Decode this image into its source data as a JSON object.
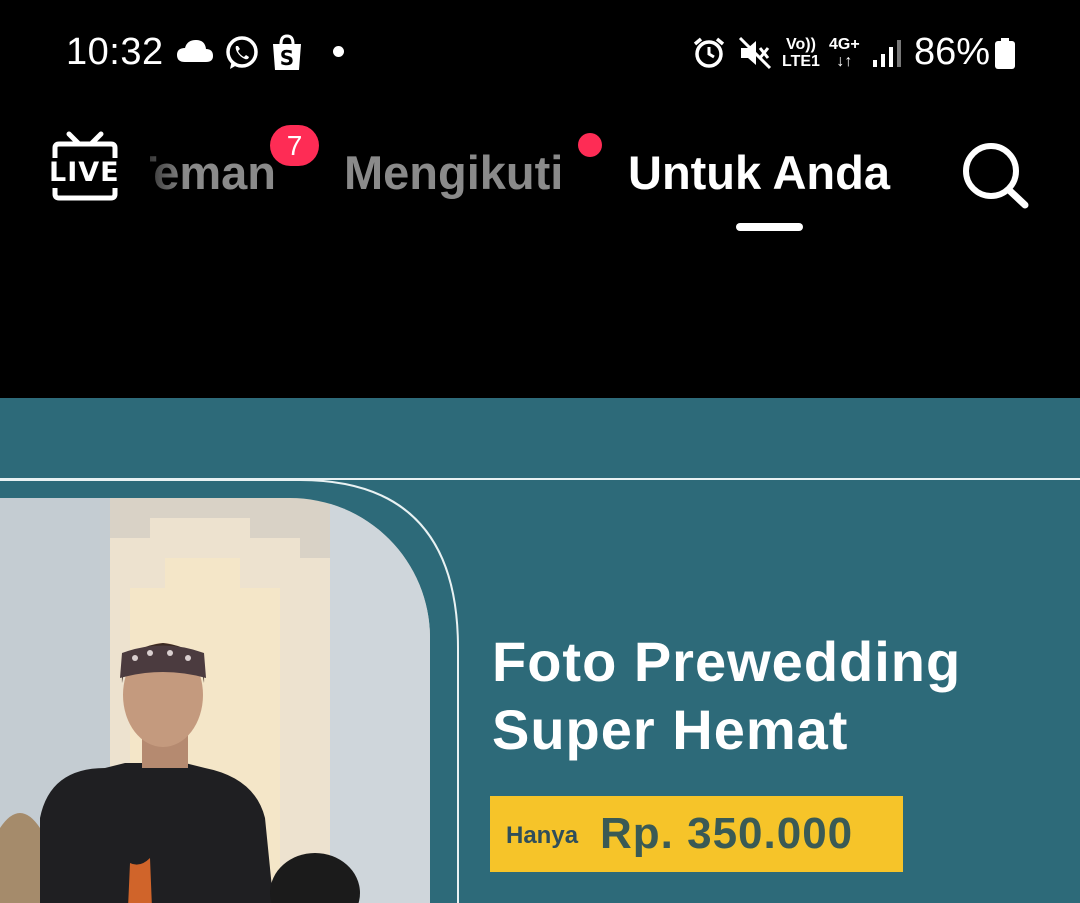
{
  "status_bar": {
    "time": "10:32",
    "icons": [
      "cloud-icon",
      "whatsapp-icon",
      "shopee-icon",
      "dot-icon",
      "alarm-icon",
      "mute-icon",
      "signal-icon",
      "battery-icon"
    ],
    "volte_line1": "Vo))",
    "volte_line2": "LTE1",
    "network_line1": "4G+",
    "network_line2": "↓↑",
    "battery": "86%"
  },
  "nav": {
    "live_label": "LIVE",
    "tab_friends": "Teman",
    "friends_badge": "7",
    "tab_following": "Mengikuti",
    "tab_for_you": "Untuk Anda",
    "active_tab": "Untuk Anda"
  },
  "ad": {
    "title_line1": "Foto Prewedding",
    "title_line2": "Super Hemat",
    "price_label": "Hanya",
    "price_value": "Rp. 350.000"
  },
  "colors": {
    "background": "#000000",
    "accent_red": "#fe2c55",
    "ad_teal": "#2d6a79",
    "price_yellow": "#f6c429",
    "inactive_tab": "#8a8a8a"
  }
}
